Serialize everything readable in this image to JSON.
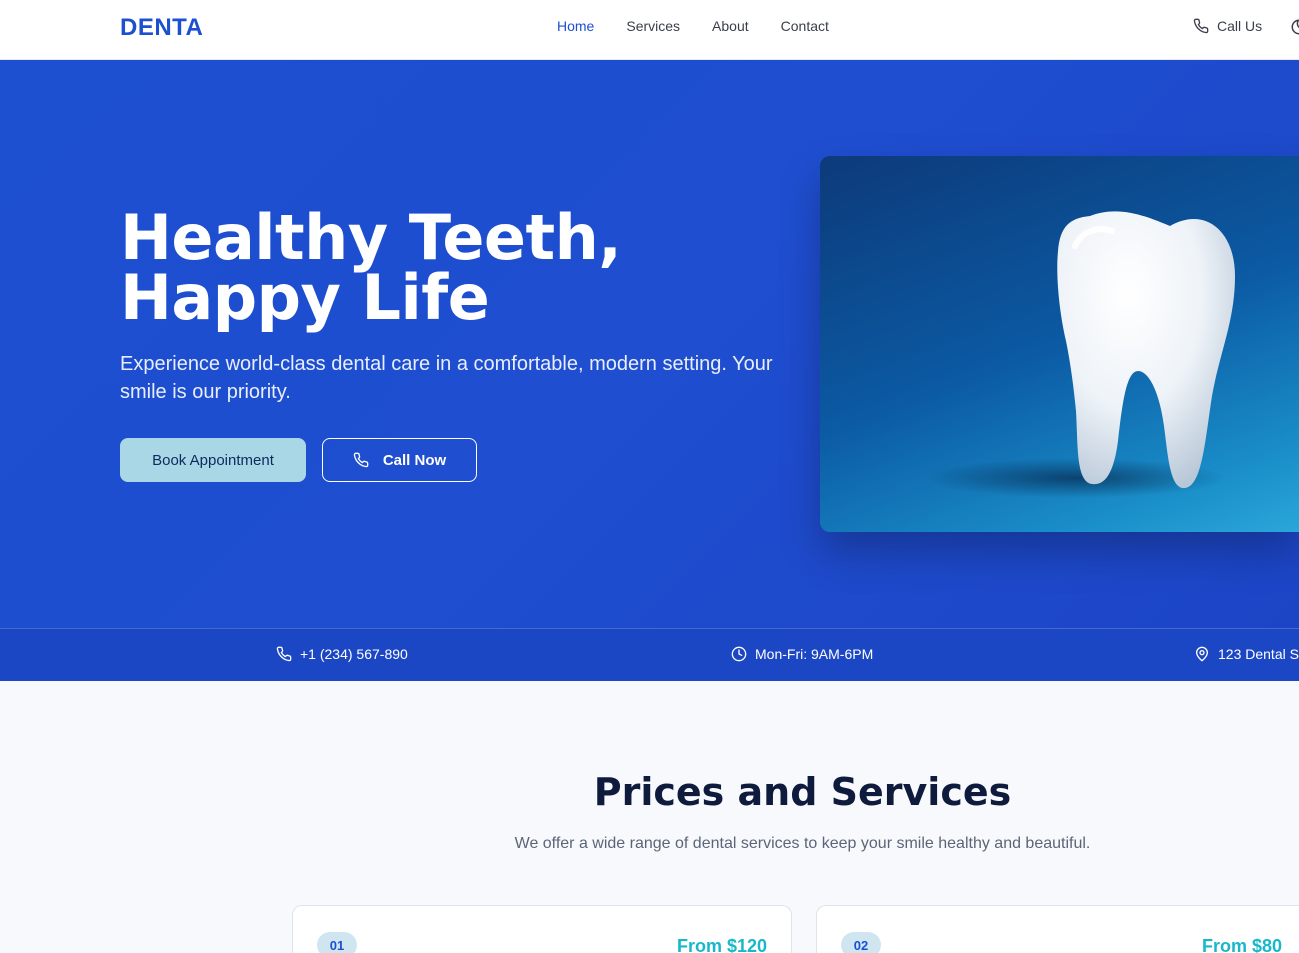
{
  "brand": {
    "name": "DENTA",
    "accent": "#1d4fd1"
  },
  "nav": {
    "items": [
      {
        "label": "Home",
        "active": true
      },
      {
        "label": "Services",
        "active": false
      },
      {
        "label": "About",
        "active": false
      },
      {
        "label": "Contact",
        "active": false
      }
    ],
    "call_label": "Call Us",
    "call_icon": "phone-icon",
    "theme_icon": "moon-icon"
  },
  "hero": {
    "title": "Healthy Teeth, Happy Life",
    "subtitle": "Experience world-class dental care in a comfortable, modern setting. Your smile is our priority.",
    "book_label": "Book Appointment",
    "call_label": "Call Now",
    "image_icon": "tooth-icon"
  },
  "info_bar": {
    "phone": "+1 (234) 567-890",
    "hours": "Mon-Fri: 9AM-6PM",
    "address": "123 Dental S"
  },
  "services": {
    "title": "Prices and Services",
    "subtitle": "We offer a wide range of dental services to keep your smile healthy and beautiful.",
    "cards": [
      {
        "number": "01",
        "price": "From $120"
      },
      {
        "number": "02",
        "price": "From $80"
      }
    ]
  }
}
